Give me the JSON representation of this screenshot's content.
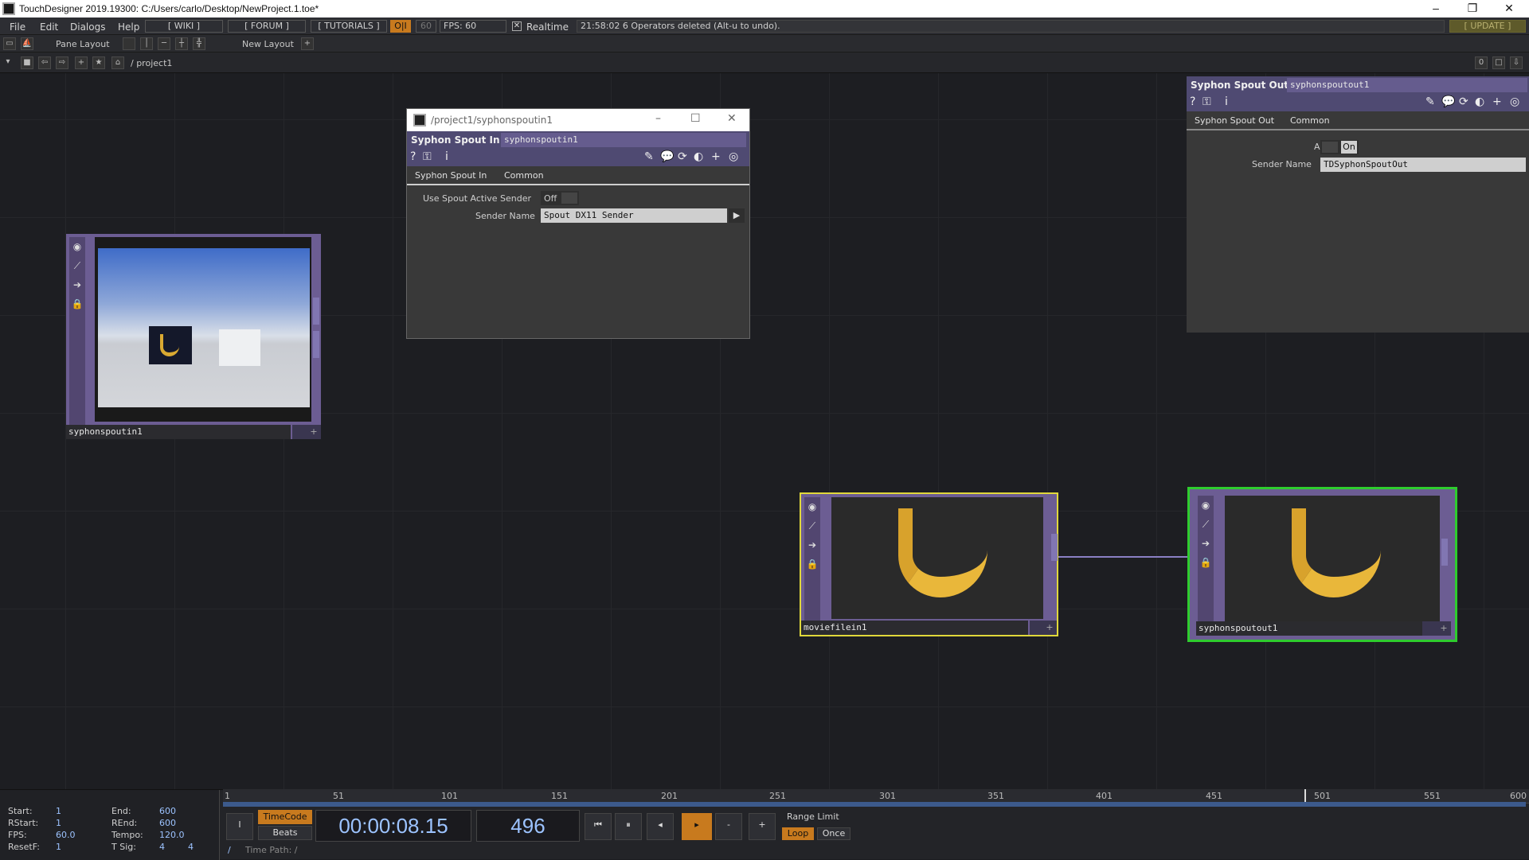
{
  "window": {
    "title": "TouchDesigner 2019.19300: C:/Users/carlo/Desktop/NewProject.1.toe*"
  },
  "menu": {
    "file": "File",
    "edit": "Edit",
    "dialogs": "Dialogs",
    "help": "Help",
    "wiki": "[ WIKI ]",
    "forum": "[ FORUM ]",
    "tutorials": "[ TUTORIALS ]",
    "oi": "O|I",
    "fps_set": "60",
    "fps_label": "FPS:  60",
    "realtime": "Realtime",
    "status": "21:58:02 6 Operators deleted (Alt-u to undo).",
    "update": "[ UPDATE ]"
  },
  "toolbar": {
    "pane_layout": "Pane Layout",
    "new_layout": "New Layout",
    "plus": "+"
  },
  "nav": {
    "path": "/ project1",
    "zero": "0"
  },
  "nodes": {
    "syphonspoutin": "syphonspoutin1",
    "moviefilein": "moviefilein1",
    "syphonspoutout": "syphonspoutout1"
  },
  "popup": {
    "title": "/project1/syphonspoutin1",
    "type": "Syphon Spout In",
    "name": "syphonspoutin1",
    "tab1": "Syphon Spout In",
    "tab2": "Common",
    "p1_label": "Use Spout Active Sender",
    "p1_value": "Off",
    "p2_label": "Sender Name",
    "p2_value": "Spout DX11 Sender"
  },
  "param": {
    "type": "Syphon Spout Out",
    "name": "syphonspoutout1",
    "tab1": "Syphon Spout Out",
    "tab2": "Common",
    "p1_label": "Active",
    "p1_value": "On",
    "p2_label": "Sender Name",
    "p2_value": "TDSyphonSpoutOut"
  },
  "timeline": {
    "ruler": [
      "1",
      "51",
      "101",
      "151",
      "201",
      "251",
      "301",
      "351",
      "401",
      "451",
      "501",
      "551",
      "600"
    ],
    "current_frame_fraction": 0.83,
    "start_label": "Start:",
    "start": "1",
    "end_label": "End:",
    "end": "600",
    "rstart_label": "RStart:",
    "rstart": "1",
    "rend_label": "REnd:",
    "rend": "600",
    "fps_label": "FPS:",
    "fps": "60.0",
    "tempo_label": "Tempo:",
    "tempo": "120.0",
    "resetf_label": "ResetF:",
    "resetf": "1",
    "tsig_label": "T Sig:",
    "tsig_a": "4",
    "tsig_b": "4",
    "timecode": "TimeCode",
    "beats": "Beats",
    "time": "00:00:08.15",
    "frame": "496",
    "range_limit": "Range Limit",
    "loop": "Loop",
    "once": "Once",
    "timepath": "Time Path: /",
    "i": "I",
    "slash": "/",
    "minus": "-",
    "plus": "+"
  }
}
